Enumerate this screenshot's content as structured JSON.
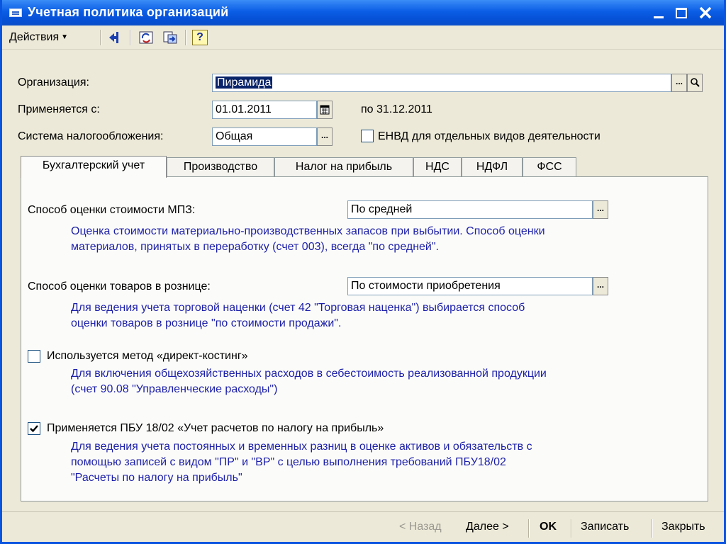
{
  "window": {
    "title": "Учетная политика организаций"
  },
  "toolbar": {
    "actions_label": "Действия",
    "help_label": "?"
  },
  "header": {
    "org_label": "Организация:",
    "org_value": "Пирамида",
    "applies_label": "Применяется с:",
    "applies_date": "01.01.2011",
    "period_end": "по 31.12.2011",
    "tax_label": "Система налогообложения:",
    "tax_value": "Общая",
    "envd_label": "ЕНВД для отдельных видов деятельности",
    "envd_checked": false
  },
  "tabs": [
    {
      "label": "Бухгалтерский учет",
      "active": true
    },
    {
      "label": "Производство",
      "active": false
    },
    {
      "label": "Налог на прибыль",
      "active": false
    },
    {
      "label": "НДС",
      "active": false
    },
    {
      "label": "НДФЛ",
      "active": false
    },
    {
      "label": "ФСС",
      "active": false
    }
  ],
  "accounting": {
    "mpz_label": "Способ оценки стоимости МПЗ:",
    "mpz_value": "По средней",
    "mpz_hint_1": "Оценка стоимости материально-производственных запасов при выбытии. Способ оценки",
    "mpz_hint_2": "материалов, принятых в переработку (счет 003), всегда \"по средней\".",
    "retail_label": "Способ оценки товаров в рознице:",
    "retail_value": "По стоимости приобретения",
    "retail_hint_1": "Для ведения учета торговой наценки (счет 42 \"Торговая наценка\") выбирается способ",
    "retail_hint_2": "оценки товаров в рознице \"по стоимости продажи\".",
    "direct_label": "Используется метод «директ-костинг»",
    "direct_checked": false,
    "direct_hint_1": "Для включения общехозяйственных расходов в себестоимость реализованной продукции",
    "direct_hint_2": "(счет 90.08 \"Управленческие расходы\")",
    "pbu_label": "Применяется ПБУ 18/02 «Учет расчетов по налогу на прибыль»",
    "pbu_checked": true,
    "pbu_hint_1": "Для ведения учета постоянных и временных разниц в оценке активов и обязательств с",
    "pbu_hint_2": "помощью записей с видом \"ПР\" и \"ВР\" с целью выполнения требований ПБУ18/02",
    "pbu_hint_3": "\"Расчеты по налогу на прибыль\""
  },
  "footer": {
    "back_label": "< Назад",
    "next_label": "Далее >",
    "ok_label": "OK",
    "save_label": "Записать",
    "close_label": "Закрыть"
  },
  "icons": {
    "window": "list-window-icon",
    "nav_back": "arrow-left-icon",
    "refresh": "refresh-icon",
    "goto": "goto-icon",
    "help": "help-icon",
    "calendar": "calendar-icon",
    "search": "magnifier-icon"
  },
  "colors": {
    "titlebar": "#0b5de5",
    "dialog_bg": "#ece9d8",
    "hint_text": "#1c1fa8",
    "selection": "#0a246a"
  }
}
